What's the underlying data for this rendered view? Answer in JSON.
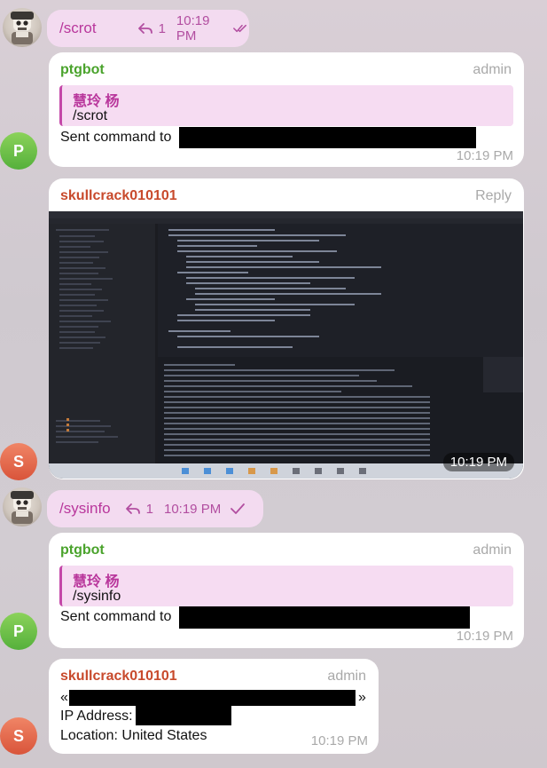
{
  "messages": [
    {
      "type": "outgoing",
      "text": "/scrot",
      "replies": "1",
      "time": "10:19 PM",
      "status": "read"
    },
    {
      "type": "incoming",
      "sender": "ptgbot",
      "role": "admin",
      "quote_name": "慧玲 杨",
      "quote_text": "/scrot",
      "text": "Sent command to",
      "time": "10:19 PM",
      "avatar": "P"
    },
    {
      "type": "incoming-photo",
      "sender": "skullcrack010101",
      "action": "Reply",
      "time": "10:19 PM",
      "avatar": "S"
    },
    {
      "type": "outgoing",
      "text": "/sysinfo",
      "replies": "1",
      "time": "10:19 PM",
      "status": "sent"
    },
    {
      "type": "incoming",
      "sender": "ptgbot",
      "role": "admin",
      "quote_name": "慧玲 杨",
      "quote_text": "/sysinfo",
      "text": "Sent command to",
      "time": "10:19 PM",
      "avatar": "P"
    },
    {
      "type": "incoming",
      "sender": "skullcrack010101",
      "role": "admin",
      "open_quote": "«",
      "close_quote": "»",
      "ip_label": "IP Address:",
      "location": "Location: United States",
      "time": "10:19 PM",
      "avatar": "S"
    }
  ],
  "icons": {
    "reply": "reply-arrow-icon",
    "read": "double-check-icon",
    "sent": "single-check-icon"
  }
}
